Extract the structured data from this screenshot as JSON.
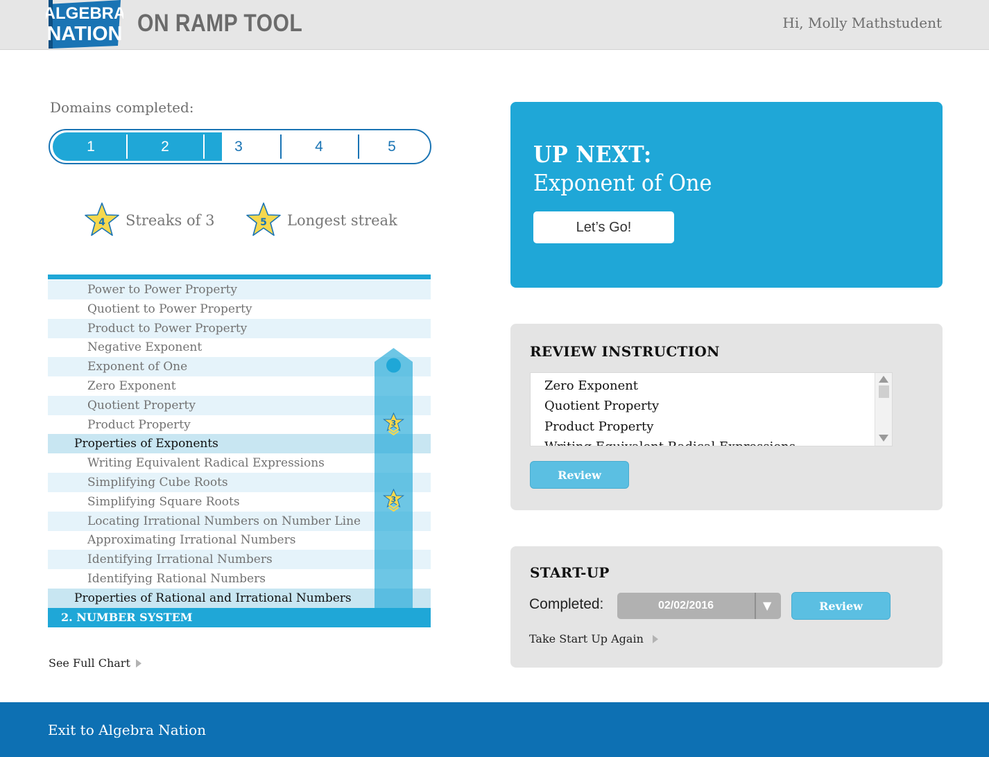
{
  "header": {
    "logo_line1": "ALGEBRA",
    "logo_line2": "NATION",
    "app_title": "ON RAMP TOOL",
    "greeting": "Hi, Molly Mathstudent"
  },
  "domains": {
    "label": "Domains completed:",
    "items": [
      "1",
      "2",
      "3",
      "4",
      "5"
    ],
    "completed_count": 2
  },
  "streaks": {
    "streaks_of_3": {
      "value": "4",
      "label": "Streaks of 3"
    },
    "longest": {
      "value": "5",
      "label": "Longest streak"
    }
  },
  "progress_chart": {
    "rows": [
      {
        "label": "Power to Power Property",
        "kind": "sub"
      },
      {
        "label": "Quotient to Power Property",
        "kind": "sub"
      },
      {
        "label": "Product to Power Property",
        "kind": "sub"
      },
      {
        "label": "Negative Exponent",
        "kind": "sub"
      },
      {
        "label": "Exponent of One",
        "kind": "sub"
      },
      {
        "label": "Zero Exponent",
        "kind": "sub"
      },
      {
        "label": "Quotient Property",
        "kind": "sub"
      },
      {
        "label": "Product Property",
        "kind": "sub"
      },
      {
        "label": "Properties of Exponents",
        "kind": "head"
      },
      {
        "label": "Writing Equivalent Radical Expressions",
        "kind": "sub"
      },
      {
        "label": "Simplifying Cube Roots",
        "kind": "sub"
      },
      {
        "label": "Simplifying Square Roots",
        "kind": "sub"
      },
      {
        "label": "Locating Irrational Numbers on Number Line",
        "kind": "sub"
      },
      {
        "label": "Approximating Irrational Numbers",
        "kind": "sub"
      },
      {
        "label": "Identifying Irrational Numbers",
        "kind": "sub"
      },
      {
        "label": "Identifying Rational Numbers",
        "kind": "sub"
      },
      {
        "label": "Properties of Rational and Irrational Numbers",
        "kind": "head"
      },
      {
        "label": "2. NUMBER SYSTEM",
        "kind": "domain"
      }
    ],
    "tube_star_value": "3",
    "current_marker_icon": "position-dot-icon"
  },
  "see_full_chart": "See Full Chart",
  "up_next": {
    "label": "UP NEXT:",
    "title": "Exponent of One",
    "button": "Let’s Go!"
  },
  "review_instruction": {
    "title": "REVIEW INSTRUCTION",
    "items": [
      "Zero Exponent",
      "Quotient Property",
      "Product Property",
      "Writing Equivalent Radical Expressions"
    ],
    "button": "Review"
  },
  "startup": {
    "title": "START-UP",
    "completed_label": "Completed:",
    "date": "02/02/2016",
    "button": "Review",
    "retake": "Take Start Up Again"
  },
  "footer": {
    "exit": "Exit to Algebra Nation"
  },
  "colors": {
    "accent": "#1fa7d7",
    "dark_blue": "#1a74b4",
    "footer": "#0d70b3",
    "star_fill": "#f6d84e"
  }
}
